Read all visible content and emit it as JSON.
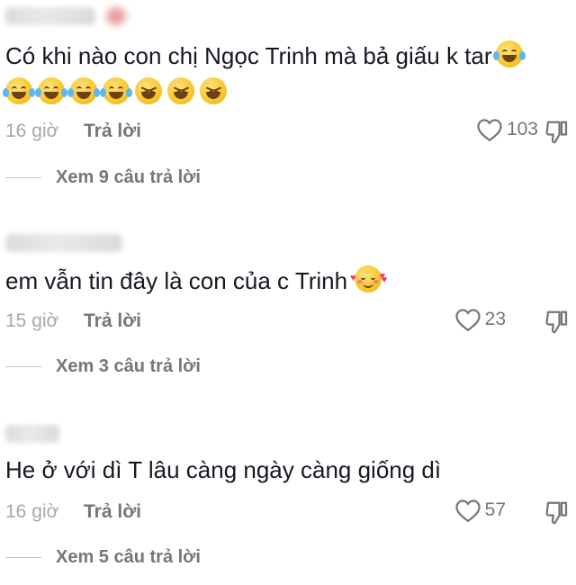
{
  "comments": [
    {
      "text": "Có khi nào con chị Ngọc Trinh mà bả giấu k tar",
      "time": "16 giờ",
      "reply_label": "Trả lời",
      "likes": "103",
      "view_replies": "Xem 9 câu trả lời",
      "emojis": [
        "joy",
        "joy",
        "joy",
        "joy",
        "joy",
        "laughing",
        "laughing",
        "laughing"
      ]
    },
    {
      "text": "em vẫn tin đây là con của c Trinh",
      "time": "15 giờ",
      "reply_label": "Trả lời",
      "likes": "23",
      "view_replies": "Xem 3 câu trả lời",
      "emojis": [
        "smiling-face-with-hearts"
      ]
    },
    {
      "text": "He ở với dì T lâu càng ngày càng giống dì",
      "time": "16 giờ",
      "reply_label": "Trả lời",
      "likes": "57",
      "view_replies": "Xem 5 câu trả lời",
      "emojis": []
    }
  ],
  "icons": {
    "like": "heart-outline-icon",
    "dislike": "thumbs-down-icon"
  },
  "colors": {
    "text": "#161823",
    "muted": "#a6a7ab",
    "secondary": "#75767b",
    "background": "#ffffff"
  }
}
